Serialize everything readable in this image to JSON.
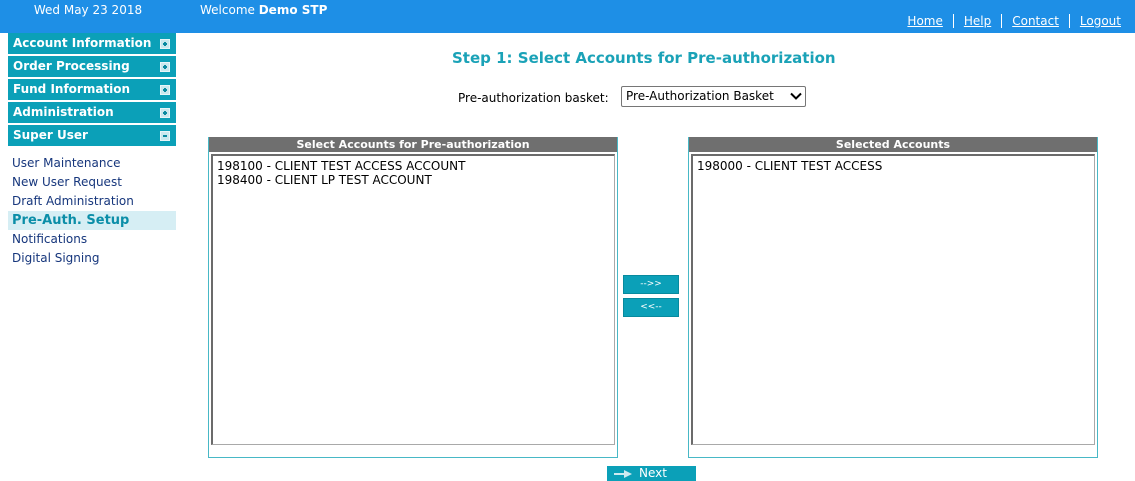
{
  "header": {
    "date": "Wed May 23 2018",
    "welcome_prefix": "Welcome",
    "user_name": "Demo STP",
    "links": [
      "Home",
      "Help",
      "Contact",
      "Logout"
    ]
  },
  "nav": {
    "sections": [
      {
        "label": "Account Information",
        "expanded": false
      },
      {
        "label": "Order Processing",
        "expanded": false
      },
      {
        "label": "Fund Information",
        "expanded": false
      },
      {
        "label": "Administration",
        "expanded": false
      },
      {
        "label": "Super User",
        "expanded": true
      }
    ],
    "super_user_items": [
      "User Maintenance",
      "New User Request",
      "Draft Administration",
      "Pre-Auth. Setup",
      "Notifications",
      "Digital Signing"
    ],
    "active_item": "Pre-Auth. Setup"
  },
  "main": {
    "title": "Step 1: Select Accounts for Pre-authorization",
    "basket_label": "Pre-authorization basket:",
    "basket_value": "Pre-Authorization Basket",
    "available": {
      "header": "Select Accounts for Pre-authorization",
      "items": [
        "198100 - CLIENT TEST ACCESS ACCOUNT",
        "198400 - CLIENT LP TEST ACCOUNT"
      ]
    },
    "selected": {
      "header": "Selected Accounts",
      "items": [
        "198000 - CLIENT TEST ACCESS"
      ]
    },
    "move_right_label": "-->>",
    "move_left_label": "<<--",
    "next_label": "Next"
  },
  "colors": {
    "topbar": "#1e8fe6",
    "nav_section": "#0ba0b8",
    "title": "#1aa2b7",
    "panel_header": "#6f6f6f"
  }
}
